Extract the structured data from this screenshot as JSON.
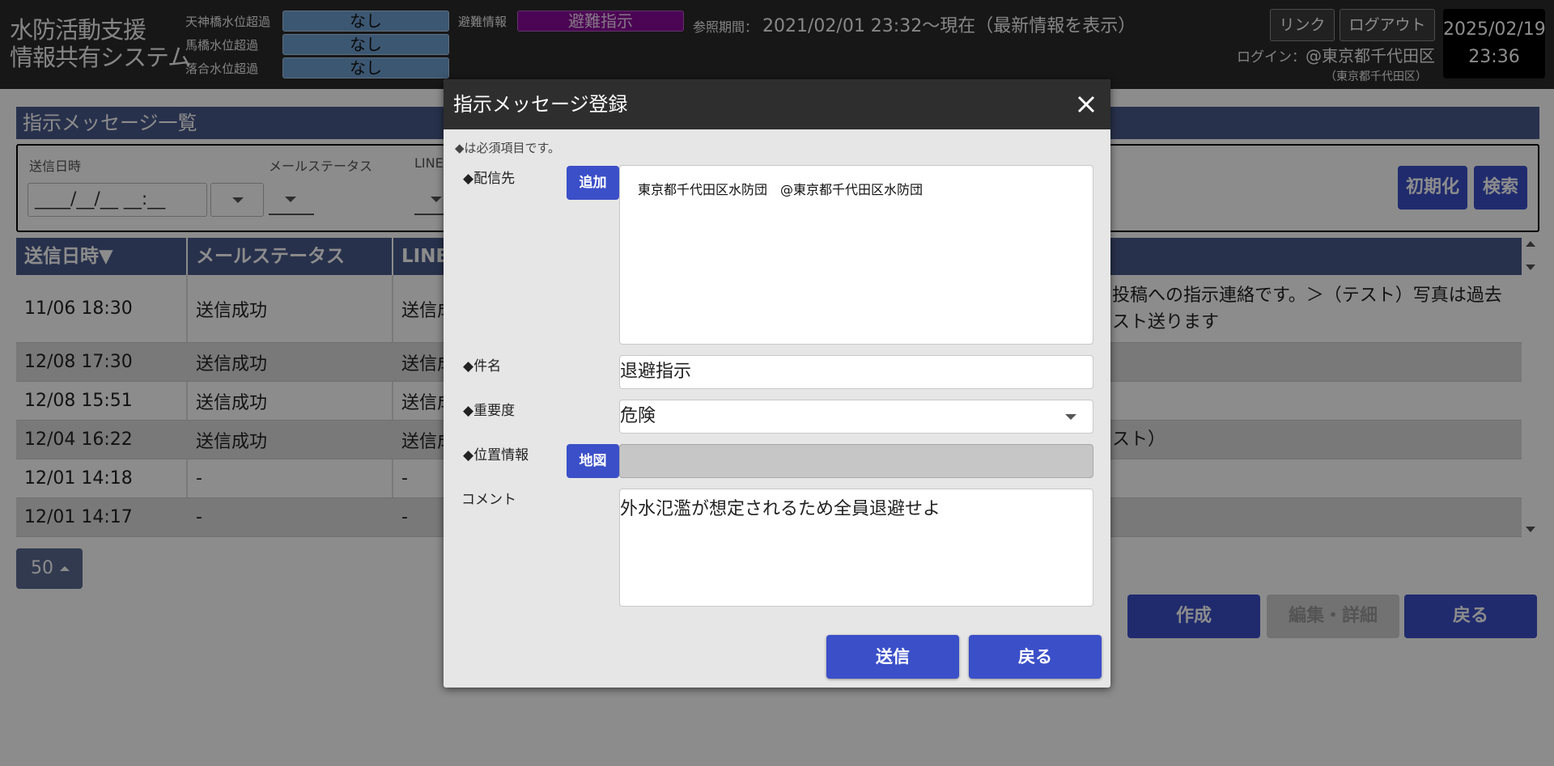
{
  "header": {
    "app_title_line1": "水防活動支援",
    "app_title_line2": "情報共有システム",
    "water_levels": [
      {
        "label": "天神橋水位超過",
        "value": "なし"
      },
      {
        "label": "馬橋水位超過",
        "value": "なし"
      },
      {
        "label": "落合水位超過",
        "value": "なし"
      }
    ],
    "evacuation_label": "避難情報",
    "evacuation_value": "避難指示",
    "ref_period_label": "参照期間：",
    "ref_period_value": "2021/02/01 23:32～現在（最新情報を表示）",
    "link_label": "リンク",
    "logout_label": "ログアウト",
    "login_label": "ログイン：",
    "login_user": "@東京都千代田区",
    "login_org": "（東京都千代田区）",
    "date": "2025/02/19",
    "time": "23:36",
    "colors": {
      "water_level": "#6e9fd0",
      "evacuation": "#8a0a9a"
    }
  },
  "page": {
    "section_title": "指示メッセージ一覧",
    "filter": {
      "send_datetime_label": "送信日時",
      "mail_status_label": "メールステータス",
      "line_label": "LINE",
      "date_placeholder": "____/__/__ __:__",
      "reset_label": "初期化",
      "search_label": "検索"
    },
    "table": {
      "headers": [
        "送信日時▼",
        "メールステータス",
        "LINE"
      ],
      "rows": [
        {
          "date": "11/06 18:30",
          "mail": "送信成功",
          "line": "送信成",
          "tail1": "投稿への指示連絡です。＞（テスト）写真は過去",
          "tail2": "スト送ります"
        },
        {
          "date": "12/08 17:30",
          "mail": "送信成功",
          "line": "送信成",
          "tail1": "",
          "tail2": ""
        },
        {
          "date": "12/08 15:51",
          "mail": "送信成功",
          "line": "送信成",
          "tail1": "",
          "tail2": ""
        },
        {
          "date": "12/04 16:22",
          "mail": "送信成功",
          "line": "送信成",
          "tail1": "スト）",
          "tail2": ""
        },
        {
          "date": "12/01 14:18",
          "mail": "-",
          "line": "-",
          "tail1": "",
          "tail2": ""
        },
        {
          "date": "12/01 14:17",
          "mail": "-",
          "line": "-",
          "tail1": "",
          "tail2": ""
        }
      ]
    },
    "page_size": "50",
    "create_label": "作成",
    "edit_label": "編集・詳細",
    "back_label": "戻る"
  },
  "modal": {
    "title": "指示メッセージ登録",
    "required_note": "◆は必須項目です。",
    "recipients_label": "◆配信先",
    "add_label": "追加",
    "recipients_value": "東京都千代田区水防団　@東京都千代田区水防団",
    "subject_label": "◆件名",
    "subject_value": "退避指示",
    "severity_label": "◆重要度",
    "severity_value": "危険",
    "location_label": "◆位置情報",
    "map_label": "地図",
    "comment_label": "コメント",
    "comment_value": "外水氾濫が想定されるため全員退避せよ",
    "send_label": "送信",
    "back_label": "戻る"
  }
}
